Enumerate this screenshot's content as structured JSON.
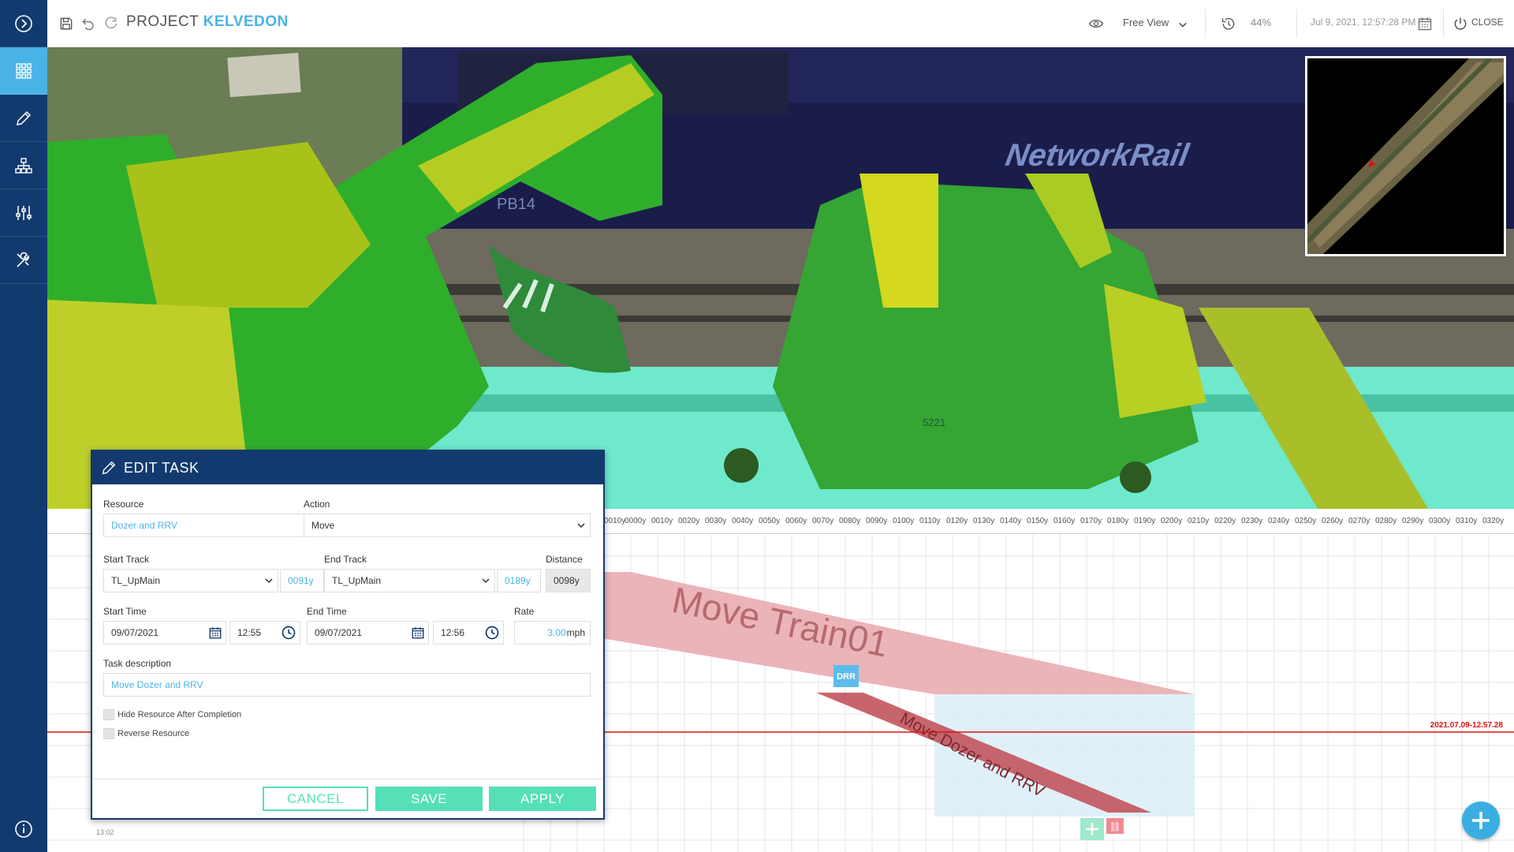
{
  "header": {
    "project_prefix": "PROJECT",
    "project_name": "KELVEDON",
    "view_mode": "Free View",
    "progress": "44%",
    "datetime": "Jul 9, 2021, 12:57:28 PM",
    "close_label": "CLOSE"
  },
  "sidebar": {
    "items": [
      {
        "icon": "chevron-right-circle-icon"
      },
      {
        "icon": "grid-icon",
        "active": true
      },
      {
        "icon": "pencil-icon"
      },
      {
        "icon": "hierarchy-icon"
      },
      {
        "icon": "sliders-icon"
      },
      {
        "icon": "tools-icon"
      }
    ],
    "bottom_icon": "info-icon"
  },
  "viewport": {
    "loco_text": "NetworkRail",
    "loco_number": "PB14",
    "unit_number": "5221"
  },
  "timeline": {
    "ticks": [
      "0010y",
      "0000y",
      "0010y",
      "0020y",
      "0030y",
      "0040y",
      "0050y",
      "0060y",
      "0070y",
      "0080y",
      "0090y",
      "0100y",
      "0110y",
      "0120y",
      "0130y",
      "0140y",
      "0150y",
      "0160y",
      "0170y",
      "0180y",
      "0190y",
      "0200y",
      "0210y",
      "0220y",
      "0230y",
      "0240y",
      "0250y",
      "0260y",
      "0270y",
      "0280y",
      "0290y",
      "0300y",
      "0310y",
      "0320y"
    ],
    "task_train": "Move Train01",
    "task_dozer": "Move Dozer and RRV",
    "badge": "DRR",
    "now_label": "2021.07.09-12.57.28",
    "time_label": "13:02"
  },
  "edit_task": {
    "title": "EDIT TASK",
    "resource_label": "Resource",
    "resource_value": "Dozer and RRV",
    "action_label": "Action",
    "action_value": "Move",
    "start_track_label": "Start Track",
    "start_track_value": "TL_UpMain",
    "start_track_pos": "0091y",
    "end_track_label": "End Track",
    "end_track_value": "TL_UpMain",
    "end_track_pos": "0189y",
    "distance_label": "Distance",
    "distance_value": "0098y",
    "start_time_label": "Start Time",
    "start_date": "09/07/2021",
    "start_clock": "12:55",
    "end_time_label": "End Time",
    "end_date": "09/07/2021",
    "end_clock": "12:56",
    "rate_label": "Rate",
    "rate_value": "3.00",
    "rate_unit": "mph",
    "desc_label": "Task description",
    "desc_value": "Move Dozer and RRV",
    "hide_resource_label": "Hide Resource After Completion",
    "reverse_resource_label": "Reverse Resource",
    "cancel": "CANCEL",
    "save": "SAVE",
    "apply": "APPLY"
  },
  "colors": {
    "sidebar": "#123a6e",
    "accent": "#4ab3e6",
    "button": "#55e0b8",
    "now_line": "#e01010"
  }
}
